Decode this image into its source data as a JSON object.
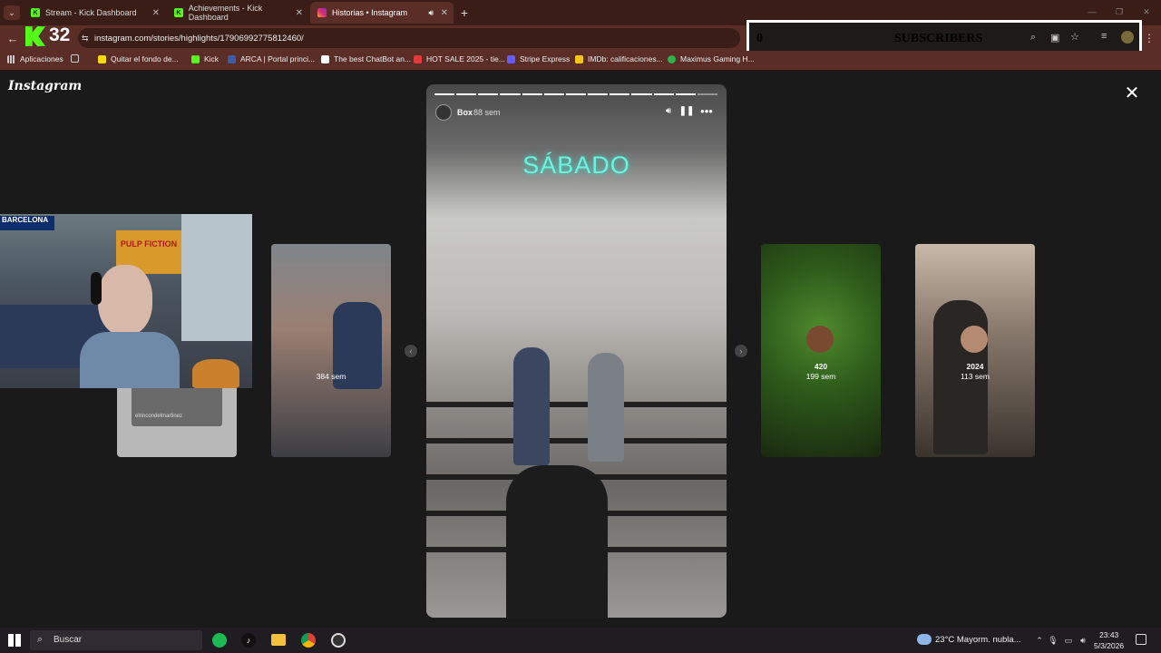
{
  "tabs": [
    {
      "title": "Stream - Kick Dashboard",
      "active": false
    },
    {
      "title": "Achievements - Kick Dashboard",
      "active": false
    },
    {
      "title": "Historias • Instagram",
      "active": true
    }
  ],
  "toolbar": {
    "url": "instagram.com/stories/highlights/17906992775812460/",
    "kick_count": "32",
    "overlay_count": "0",
    "overlay_label": "SUBSCRIBERS"
  },
  "bookmarks": [
    {
      "label": "Aplicaciones",
      "color": "#aaaaaa"
    },
    {
      "label": "Quitar el fondo de...",
      "color": "#f5d90a"
    },
    {
      "label": "Kick",
      "color": "#53fc18"
    },
    {
      "label": "ARCA | Portal princi...",
      "color": "#3b5ba8"
    },
    {
      "label": "The best ChatBot an...",
      "color": "#ffffff"
    },
    {
      "label": "HOT SALE 2025 - tie...",
      "color": "#e03a3a"
    },
    {
      "label": "Stripe Express",
      "color": "#635bff"
    },
    {
      "label": "IMDb: calificaciones...",
      "color": "#f5c518"
    },
    {
      "label": "Maximus Gaming H...",
      "color": "#2fb24c"
    }
  ],
  "instagram": {
    "logo": "Instagram",
    "story": {
      "username": "Box",
      "time": "88 sem",
      "text": "SÁBADO"
    },
    "cards": [
      {
        "count": "",
        "time": "384 sem",
        "sub": ""
      },
      {
        "count": "420",
        "time": "199 sem",
        "sub": ""
      },
      {
        "count": "2024",
        "time": "113 sem",
        "sub": ""
      }
    ],
    "card_faded_caption": "elrincondelmartinez"
  },
  "taskbar": {
    "search": "Buscar",
    "weather": "23°C  Mayorm. nubla...",
    "time": "23:43",
    "date": "5/3/2026"
  },
  "colors": {
    "kick_green": "#53fc18",
    "tab_bg": "#3b1d17",
    "toolbar_bg": "#5a2e26"
  }
}
